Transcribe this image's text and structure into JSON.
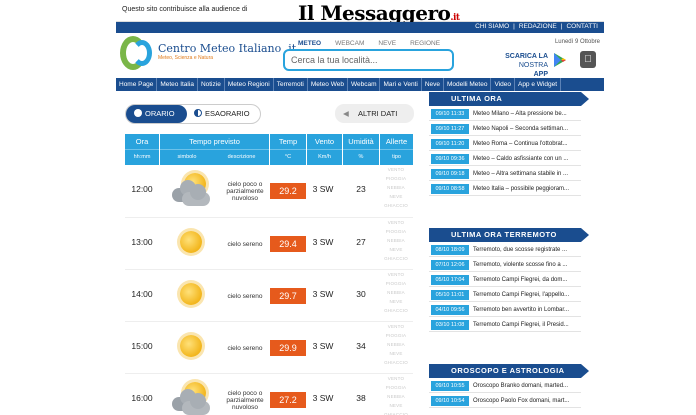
{
  "topbar": {
    "note": "Questo sito contribuisce alla audience di",
    "logo": "Il Messaggero",
    "logo_suffix": ".it",
    "links": [
      "CHI SIAMO",
      "|",
      "REDAZIONE",
      "|",
      "CONTATTI"
    ]
  },
  "brand": {
    "name": "Centro Meteo Italiano .it",
    "tagline": "Meteo, Scienza e Natura"
  },
  "search": {
    "tabs": [
      "METEO",
      "WEBCAM",
      "NEVE",
      "REGIONE"
    ],
    "active_tab": "METEO",
    "placeholder": "Cerca la tua località..."
  },
  "date": "Lunedì 9 Ottobre",
  "app": {
    "line1": "SCARICA LA",
    "line2_a": "NOSTRA ",
    "line2_b": "APP"
  },
  "nav": [
    "Home Page",
    "Meteo Italia",
    "Notizie",
    "Meteo Regioni",
    "Terremoti",
    "Meteo Web",
    "Webcam",
    "Mari e Venti",
    "Neve",
    "Modelli Meteo",
    "Video",
    "App e Widget"
  ],
  "toggle": {
    "hourly": "ORARIO",
    "threehour": "ESAORARIO"
  },
  "altri_dati": "ALTRI DATI",
  "altri_arrow": "◀",
  "table_head": {
    "ora": "Ora",
    "ora_sub": "hh:mm",
    "tempo": "Tempo previsto",
    "simbolo": "simbolo",
    "descrizione": "descrizione",
    "temp": "Temp",
    "temp_sub": "°C",
    "vento": "Vento",
    "vento_sub": "Km/h",
    "umidita": "Umidità",
    "umidita_sub": "%",
    "allerte": "Allerte",
    "allerte_sub": "tipo"
  },
  "rows": [
    {
      "ora": "12:00",
      "icon": "partly-cloudy",
      "desc": "cielo poco o parzialmente nuvoloso",
      "temp": "29.2",
      "vento": "3 SW",
      "umidita": "23"
    },
    {
      "ora": "13:00",
      "icon": "sunny",
      "desc": "cielo sereno",
      "temp": "29.4",
      "vento": "3 SW",
      "umidita": "27"
    },
    {
      "ora": "14:00",
      "icon": "sunny",
      "desc": "cielo sereno",
      "temp": "29.7",
      "vento": "3 SW",
      "umidita": "30"
    },
    {
      "ora": "15:00",
      "icon": "sunny",
      "desc": "cielo sereno",
      "temp": "29.9",
      "vento": "3 SW",
      "umidita": "34"
    },
    {
      "ora": "16:00",
      "icon": "partly-cloudy",
      "desc": "cielo poco o parzialmente nuvoloso",
      "temp": "27.2",
      "vento": "3 SW",
      "umidita": "38"
    }
  ],
  "allerte_words": [
    "VENTO",
    "PIOGGIA",
    "NEBBIA",
    "NEVE",
    "GHIACCIO"
  ],
  "ultima_ora": {
    "title": "ULTIMA ORA",
    "items": [
      {
        "time": "09/10 11:33",
        "text": "Meteo Milano – Alta pressione be..."
      },
      {
        "time": "09/10 11:27",
        "text": "Meteo Napoli – Seconda settiman..."
      },
      {
        "time": "09/10 11:20",
        "text": "Meteo Roma – Continua l'ottobrat..."
      },
      {
        "time": "09/10 09:36",
        "text": "Meteo – Caldo asfissiante con un ..."
      },
      {
        "time": "09/10 09:18",
        "text": "Meteo – Altra settimana stabile in ..."
      },
      {
        "time": "09/10 08:58",
        "text": "Meteo Italia – possibile peggioram..."
      }
    ]
  },
  "terremoto": {
    "title": "ULTIMA ORA TERREMOTO",
    "items": [
      {
        "time": "08/10 18:09",
        "text": "Terremoto, due scosse registrate ..."
      },
      {
        "time": "07/10 12:06",
        "text": "Terremoto, violente scosse fino a ..."
      },
      {
        "time": "05/10 17:04",
        "text": "Terremoto Campi Flegrei, da dom..."
      },
      {
        "time": "05/10 11:01",
        "text": "Terremoto Campi Flegrei, l'appello..."
      },
      {
        "time": "04/10 09:56",
        "text": "Terremoto ben avvertito in Lombar..."
      },
      {
        "time": "03/10 11:08",
        "text": "Terremoto Campi Flegrei, il Presid..."
      }
    ]
  },
  "oroscopo": {
    "title": "OROSCOPO E ASTROLOGIA",
    "items": [
      {
        "time": "09/10 10:55",
        "text": "Oroscopo Branko domani, marted..."
      },
      {
        "time": "09/10 10:54",
        "text": "Oroscopo Paolo Fox domani, mart..."
      }
    ]
  },
  "colors": {
    "primary": "#1a4d8f",
    "accent": "#29a3dd",
    "temp": "#e65a1c"
  }
}
